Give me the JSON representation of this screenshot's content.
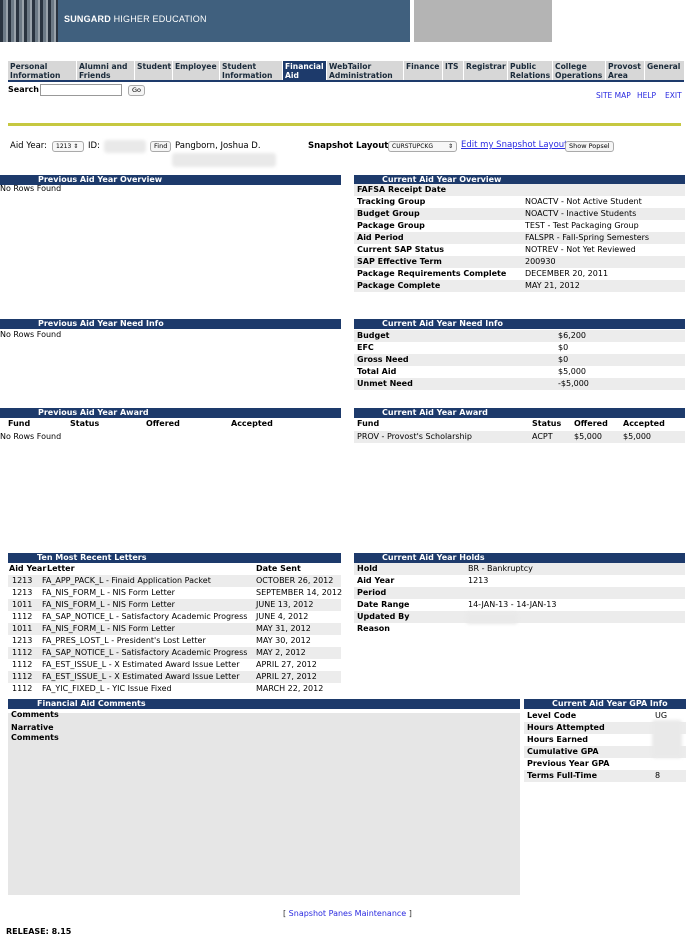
{
  "banner": {
    "brand": "SUNGARD",
    "subtitle": "HIGHER EDUCATION"
  },
  "tabs": [
    {
      "label": "Personal Information",
      "active": false
    },
    {
      "label": "Alumni and Friends",
      "active": false
    },
    {
      "label": "Student",
      "active": false
    },
    {
      "label": "Employee",
      "active": false
    },
    {
      "label": "Student Information",
      "active": false
    },
    {
      "label": "Financial Aid",
      "active": true
    },
    {
      "label": "WebTailor Administration",
      "active": false
    },
    {
      "label": "Finance",
      "active": false
    },
    {
      "label": "ITS",
      "active": false
    },
    {
      "label": "Registrar",
      "active": false
    },
    {
      "label": "Public Relations",
      "active": false
    },
    {
      "label": "College Operations",
      "active": false
    },
    {
      "label": "Provost Area",
      "active": false
    },
    {
      "label": "General",
      "active": false
    }
  ],
  "search": {
    "label": "Search",
    "value": "",
    "go_label": "Go"
  },
  "top_links": {
    "site_map": "SITE MAP",
    "help": "HELP",
    "exit": "EXIT"
  },
  "snapshot_bar": {
    "aid_year_label": "Aid Year:",
    "aid_year_value": "1213",
    "id_label": "ID:",
    "find_label": "Find",
    "student_name": "Pangborn, Joshua D.",
    "layout_label": "Snapshot Layout:",
    "layout_value": "CURSTUPCKG",
    "edit_link": "Edit my Snapshot Layout",
    "show_popsel": "Show Popsel"
  },
  "prev_overview": {
    "title": "Previous Aid Year Overview",
    "empty": "No Rows Found"
  },
  "cur_overview": {
    "title": "Current Aid Year Overview",
    "rows": [
      {
        "label": "FAFSA Receipt Date",
        "value": ""
      },
      {
        "label": "Tracking Group",
        "value": "NOACTV - Not Active Student"
      },
      {
        "label": "Budget Group",
        "value": "NOACTV - Inactive Students"
      },
      {
        "label": "Package Group",
        "value": "TEST - Test Packaging Group"
      },
      {
        "label": "Aid Period",
        "value": "FALSPR - Fall-Spring Semesters"
      },
      {
        "label": "Current SAP Status",
        "value": "NOTREV - Not Yet Reviewed"
      },
      {
        "label": "SAP Effective Term",
        "value": "200930"
      },
      {
        "label": "Package Requirements Complete",
        "value": "DECEMBER 20, 2011"
      },
      {
        "label": "Package Complete",
        "value": "MAY 21, 2012"
      }
    ]
  },
  "prev_need": {
    "title": "Previous Aid Year Need Info",
    "empty": "No Rows Found"
  },
  "cur_need": {
    "title": "Current Aid Year Need Info",
    "rows": [
      {
        "label": "Budget",
        "value": "$6,200"
      },
      {
        "label": "EFC",
        "value": "$0"
      },
      {
        "label": "Gross Need",
        "value": "$0"
      },
      {
        "label": "Total Aid",
        "value": "$5,000"
      },
      {
        "label": "Unmet Need",
        "value": "-$5,000"
      }
    ]
  },
  "prev_award": {
    "title": "Previous Aid Year Award",
    "headers": {
      "fund": "Fund",
      "status": "Status",
      "offered": "Offered",
      "accepted": "Accepted"
    },
    "empty": "No Rows Found"
  },
  "cur_award": {
    "title": "Current Aid Year Award",
    "headers": {
      "fund": "Fund",
      "status": "Status",
      "offered": "Offered",
      "accepted": "Accepted"
    },
    "rows": [
      {
        "fund": "PROV - Provost's Scholarship",
        "status": "ACPT",
        "offered": "$5,000",
        "accepted": "$5,000"
      }
    ]
  },
  "letters": {
    "title": "Ten Most Recent Letters",
    "headers": {
      "aid_year": "Aid Year",
      "letter": "Letter",
      "date_sent": "Date Sent"
    },
    "rows": [
      {
        "aid_year": "1213",
        "letter": "FA_APP_PACK_L - Finaid Application Packet",
        "date": "OCTOBER 26, 2012"
      },
      {
        "aid_year": "1213",
        "letter": "FA_NIS_FORM_L - NIS Form Letter",
        "date": "SEPTEMBER 14, 2012"
      },
      {
        "aid_year": "1011",
        "letter": "FA_NIS_FORM_L - NIS Form Letter",
        "date": "JUNE 13, 2012"
      },
      {
        "aid_year": "1112",
        "letter": "FA_SAP_NOTICE_L - Satisfactory Academic Progress",
        "date": "JUNE 4, 2012"
      },
      {
        "aid_year": "1011",
        "letter": "FA_NIS_FORM_L - NIS Form Letter",
        "date": "MAY 31, 2012"
      },
      {
        "aid_year": "1213",
        "letter": "FA_PRES_LOST_L - President's Lost Letter",
        "date": "MAY 30, 2012"
      },
      {
        "aid_year": "1112",
        "letter": "FA_SAP_NOTICE_L - Satisfactory Academic Progress",
        "date": "MAY 2, 2012"
      },
      {
        "aid_year": "1112",
        "letter": "FA_EST_ISSUE_L - X Estimated Award Issue Letter",
        "date": "APRIL 27, 2012"
      },
      {
        "aid_year": "1112",
        "letter": "FA_EST_ISSUE_L - X Estimated Award Issue Letter",
        "date": "APRIL 27, 2012"
      },
      {
        "aid_year": "1112",
        "letter": "FA_YIC_FIXED_L - YIC Issue Fixed",
        "date": "MARCH 22, 2012"
      }
    ]
  },
  "holds": {
    "title": "Current Aid Year Holds",
    "rows": [
      {
        "label": "Hold",
        "value": "BR - Bankruptcy"
      },
      {
        "label": "Aid Year",
        "value": "1213"
      },
      {
        "label": "Period",
        "value": ""
      },
      {
        "label": "Date Range",
        "value": "14-JAN-13 - 14-JAN-13"
      },
      {
        "label": "Updated By",
        "value": ""
      },
      {
        "label": "Reason",
        "value": ""
      }
    ]
  },
  "comments": {
    "title": "Financial Aid Comments",
    "comments_label": "Comments",
    "narrative_label": "Narrative Comments"
  },
  "gpa": {
    "title": "Current Aid Year GPA Info",
    "rows": [
      {
        "label": "Level Code",
        "value": "UG"
      },
      {
        "label": "Hours Attempted",
        "value": ""
      },
      {
        "label": "Hours Earned",
        "value": ""
      },
      {
        "label": "Cumulative GPA",
        "value": ""
      },
      {
        "label": "Previous Year GPA",
        "value": ""
      },
      {
        "label": "Terms Full-Time",
        "value": "8"
      }
    ]
  },
  "footer": {
    "link": "Snapshot Panes Maintenance",
    "release": "RELEASE: 8.15"
  }
}
